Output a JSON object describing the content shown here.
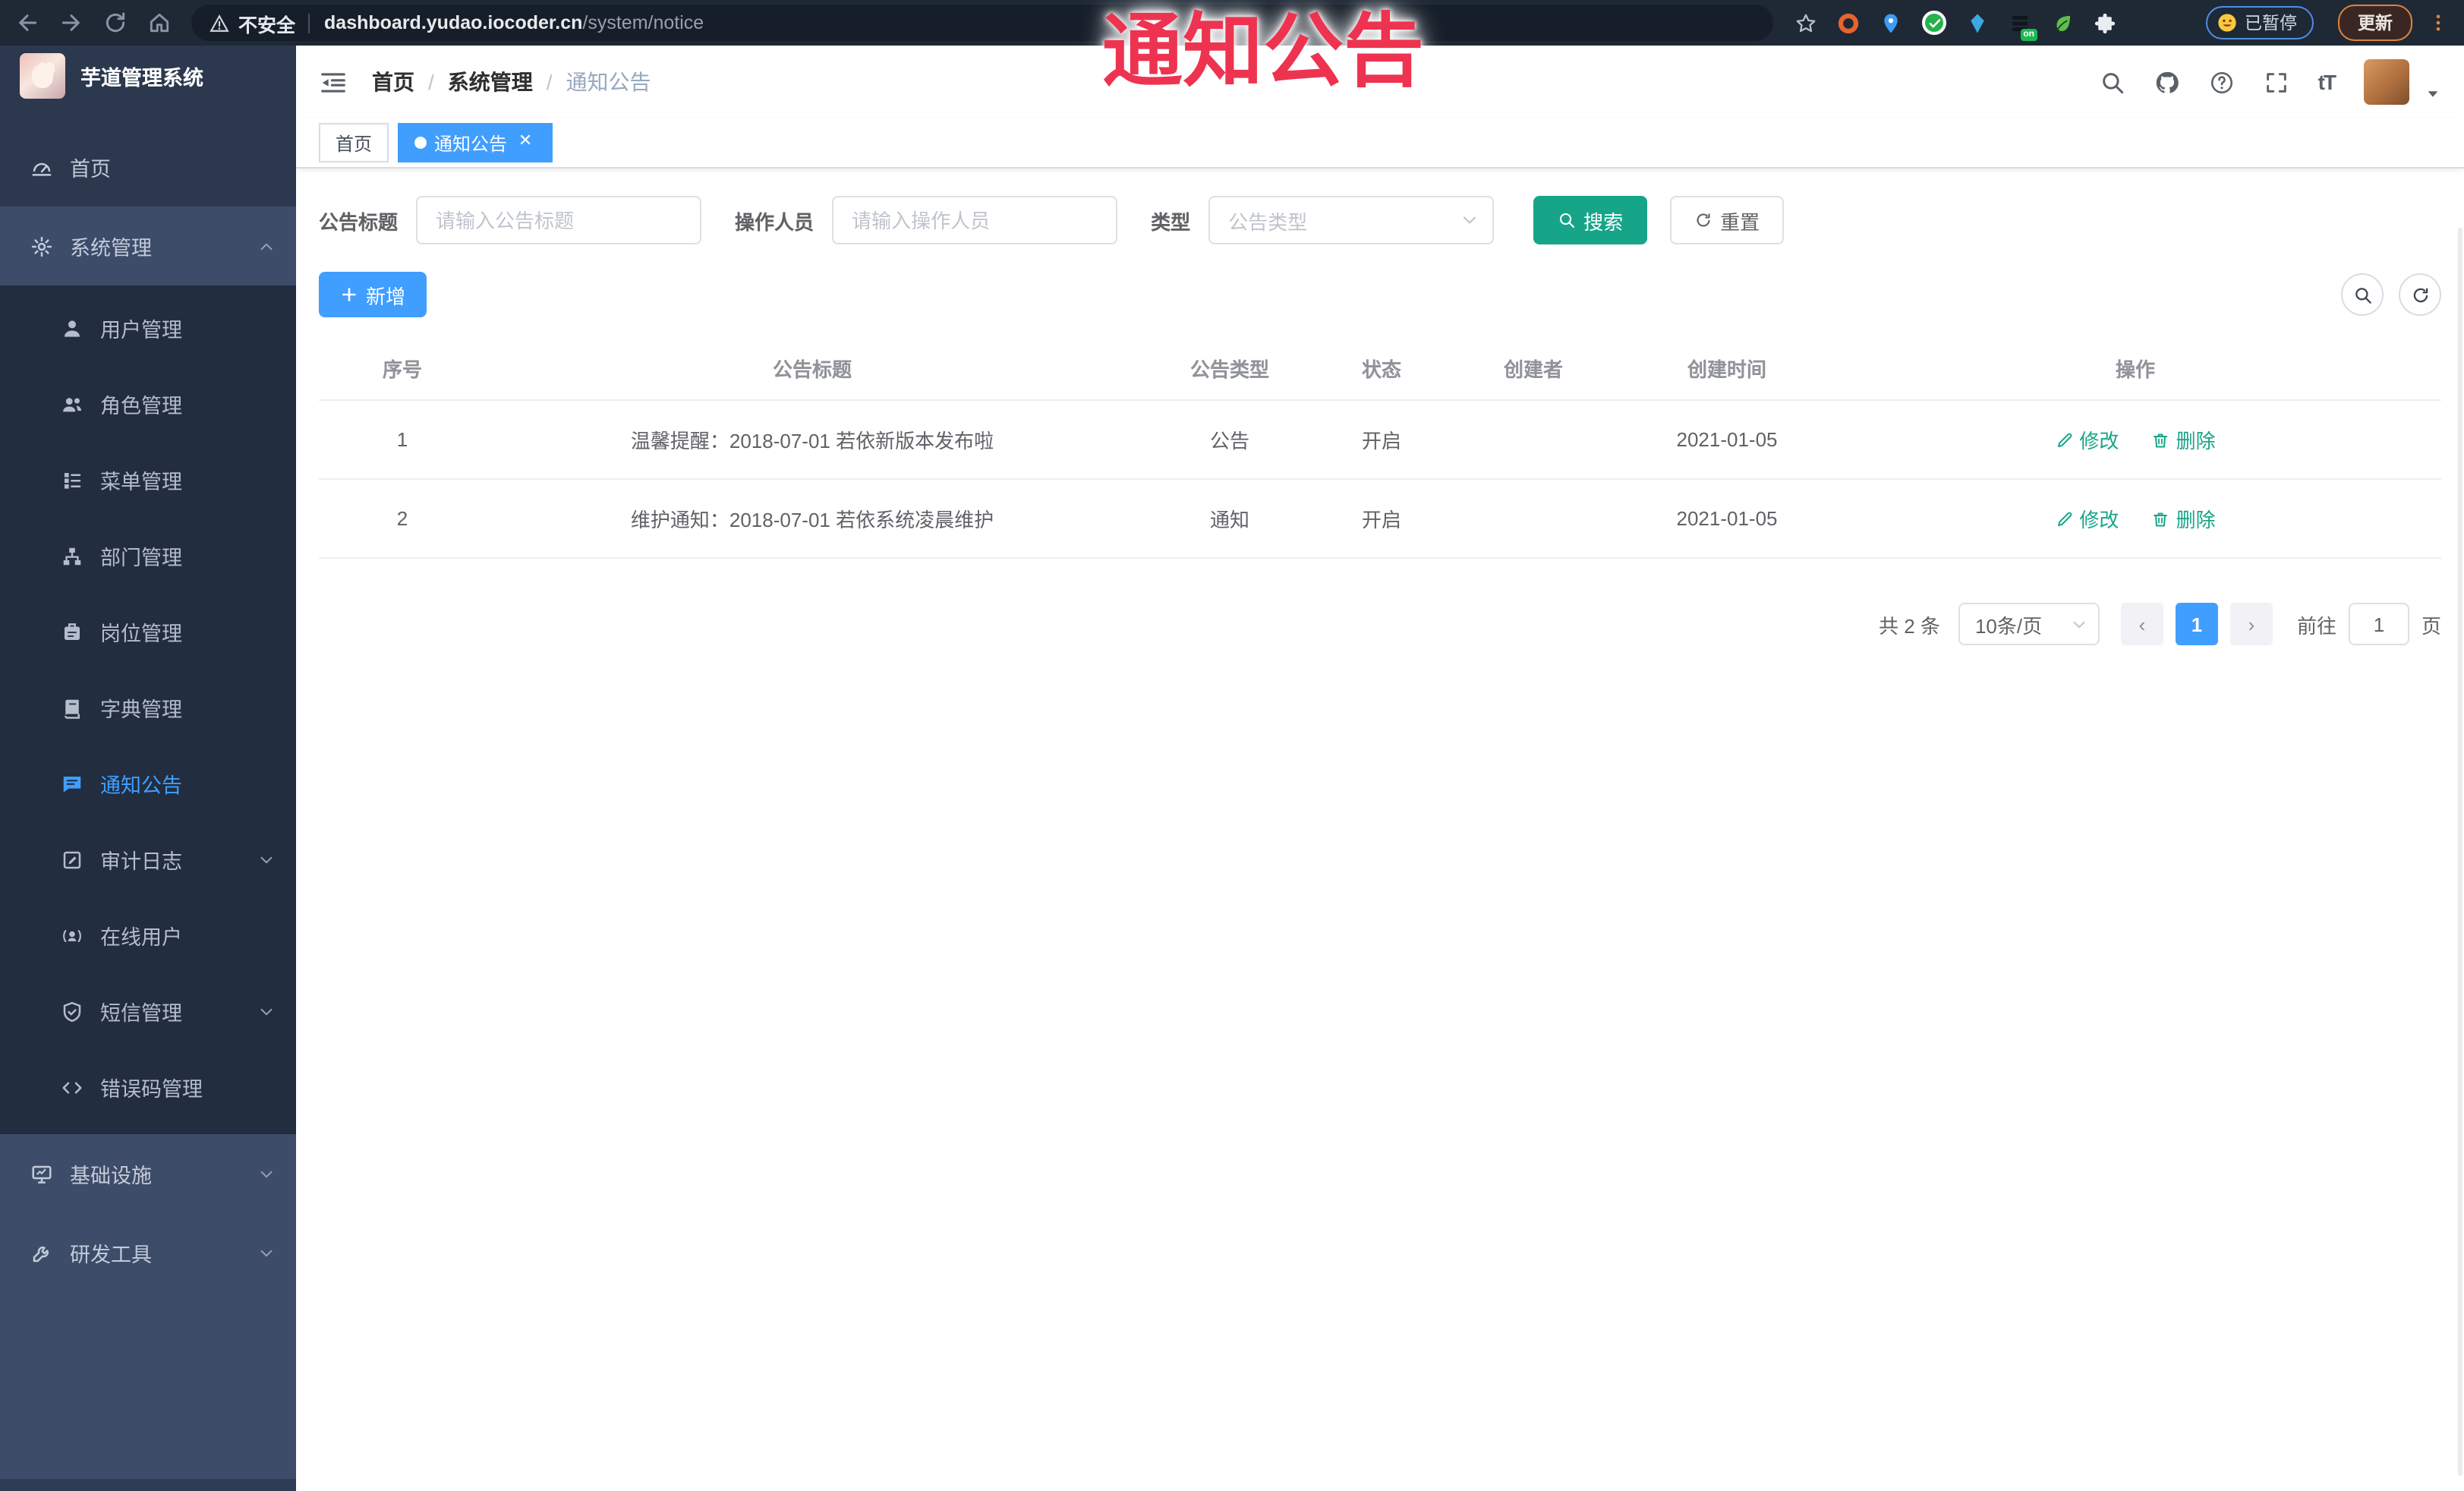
{
  "browser": {
    "security_label": "不安全",
    "url_host": "dashboard.yudao.iocoder.cn",
    "url_path": "/system/notice",
    "paused_label": "已暂停",
    "update_label": "更新",
    "on_badge": "on"
  },
  "overlay_title": "通知公告",
  "sidebar": {
    "logo_title": "芋道管理系统",
    "items": [
      {
        "label": "首页",
        "icon": "dashboard-icon"
      },
      {
        "label": "系统管理",
        "icon": "gear-icon",
        "state": "expanded"
      },
      {
        "label": "用户管理",
        "icon": "user-icon"
      },
      {
        "label": "角色管理",
        "icon": "users-icon"
      },
      {
        "label": "菜单管理",
        "icon": "menu-list-icon"
      },
      {
        "label": "部门管理",
        "icon": "org-tree-icon"
      },
      {
        "label": "岗位管理",
        "icon": "post-icon"
      },
      {
        "label": "字典管理",
        "icon": "dictionary-icon"
      },
      {
        "label": "通知公告",
        "icon": "message-icon",
        "state": "active"
      },
      {
        "label": "审计日志",
        "icon": "log-icon",
        "state": "collapsed"
      },
      {
        "label": "在线用户",
        "icon": "online-user-icon"
      },
      {
        "label": "短信管理",
        "icon": "shield-icon",
        "state": "collapsed"
      },
      {
        "label": "错误码管理",
        "icon": "code-icon"
      },
      {
        "label": "基础设施",
        "icon": "monitor-icon",
        "state": "collapsed"
      },
      {
        "label": "研发工具",
        "icon": "tool-icon",
        "state": "collapsed"
      }
    ]
  },
  "header": {
    "breadcrumb": [
      "首页",
      "系统管理",
      "通知公告"
    ]
  },
  "tags": [
    {
      "label": "首页"
    },
    {
      "label": "通知公告",
      "active": true
    }
  ],
  "filters": {
    "title_label": "公告标题",
    "title_placeholder": "请输入公告标题",
    "operator_label": "操作人员",
    "operator_placeholder": "请输入操作人员",
    "type_label": "类型",
    "type_placeholder": "公告类型",
    "search_label": "搜索",
    "reset_label": "重置"
  },
  "toolbar": {
    "add_label": "新增"
  },
  "table": {
    "columns": [
      "序号",
      "公告标题",
      "公告类型",
      "状态",
      "创建者",
      "创建时间",
      "操作"
    ],
    "rows": [
      {
        "no": "1",
        "title": "温馨提醒：2018-07-01 若依新版本发布啦",
        "type": "公告",
        "status": "开启",
        "creator": "",
        "created": "2021-01-05"
      },
      {
        "no": "2",
        "title": "维护通知：2018-07-01 若依系统凌晨维护",
        "type": "通知",
        "status": "开启",
        "creator": "",
        "created": "2021-01-05"
      }
    ],
    "edit_label": "修改",
    "delete_label": "删除"
  },
  "pagination": {
    "total": "共 2 条",
    "page_size": "10条/页",
    "page": "1",
    "goto_label": "前往",
    "goto_value": "1",
    "unit": "页"
  },
  "colors": {
    "accent_blue": "#409eff",
    "teal_action": "#17a589",
    "overlay_red": "#ee3350",
    "sidebar_bg": "#3d4c69",
    "sidebar_dark": "#2b384e",
    "submenu_bg": "#222d3f"
  }
}
